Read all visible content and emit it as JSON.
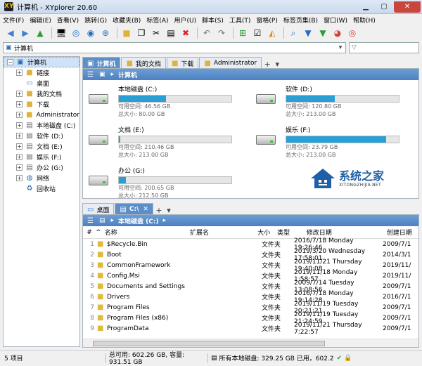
{
  "window": {
    "title": "计算机 - XYplorer 20.60",
    "app_badge": "XY"
  },
  "menu": [
    "文件(F)",
    "编辑(E)",
    "查看(V)",
    "跳转(G)",
    "收藏夹(B)",
    "标签(A)",
    "用户(U)",
    "脚本(S)",
    "工具(T)",
    "窗格(P)",
    "标签页集(B)",
    "窗口(W)",
    "帮助(H)"
  ],
  "address": {
    "value": "计算机"
  },
  "tree": [
    {
      "label": "计算机",
      "level": 0,
      "icon": "computer-icon",
      "expander": "−",
      "selected": true
    },
    {
      "label": "链接",
      "level": 1,
      "icon": "folder-icon",
      "expander": "+"
    },
    {
      "label": "桌面",
      "level": 1,
      "icon": "desktop-icon",
      "expander": ""
    },
    {
      "label": "我的文档",
      "level": 1,
      "icon": "folder-icon",
      "expander": "+"
    },
    {
      "label": "下载",
      "level": 1,
      "icon": "folder-icon",
      "expander": "+"
    },
    {
      "label": "Administrator",
      "level": 1,
      "icon": "folder-icon",
      "expander": "+"
    },
    {
      "label": "本地磁盘 (C:)",
      "level": 1,
      "icon": "drive-icon",
      "expander": "+"
    },
    {
      "label": "软件 (D:)",
      "level": 1,
      "icon": "drive-icon",
      "expander": "+"
    },
    {
      "label": "文档 (E:)",
      "level": 1,
      "icon": "drive-icon",
      "expander": "+"
    },
    {
      "label": "娱乐 (F:)",
      "level": 1,
      "icon": "drive-icon",
      "expander": "+"
    },
    {
      "label": "办公 (G:)",
      "level": 1,
      "icon": "drive-icon",
      "expander": "+"
    },
    {
      "label": "网络",
      "level": 1,
      "icon": "network-icon",
      "expander": "+"
    },
    {
      "label": "回收站",
      "level": 1,
      "icon": "recycle-bin-icon",
      "expander": ""
    }
  ],
  "upper": {
    "tabs": [
      "计算机",
      "我的文档",
      "下载",
      "Administrator"
    ],
    "path": "计算机",
    "drives": [
      {
        "name": "本地磁盘 (C:)",
        "free": "可用空间: 46.56 GB",
        "total": "总大小: 80.00 GB",
        "used_fraction": 0.42
      },
      {
        "name": "软件 (D:)",
        "free": "可用空间: 120.80 GB",
        "total": "总大小: 213.00 GB",
        "used_fraction": 0.43
      },
      {
        "name": "文档 (E:)",
        "free": "可用空间: 210.46 GB",
        "total": "总大小: 213.00 GB",
        "used_fraction": 0.01
      },
      {
        "name": "娱乐 (F:)",
        "free": "可用空间: 23.79 GB",
        "total": "总大小: 213.00 GB",
        "used_fraction": 0.89
      },
      {
        "name": "办公 (G:)",
        "free": "可用空间: 200.65 GB",
        "total": "总大小: 212.50 GB",
        "used_fraction": 0.06
      }
    ]
  },
  "lower": {
    "tabs": [
      "桌面",
      "C:\\"
    ],
    "path": "本地磁盘 (C:)",
    "columns": [
      "#",
      "名称",
      "扩展名",
      "大小",
      "类型",
      "修改日期",
      "创建日期"
    ],
    "rows": [
      {
        "n": "1",
        "name": "$Recycle.Bin",
        "type": "文件夹",
        "modified": "2016/7/18 Monday 19:26:46",
        "created": "2009/7/1"
      },
      {
        "n": "2",
        "name": "Boot",
        "type": "文件夹",
        "modified": "2019/3/20 Wednesday 17:58:01",
        "created": "2014/3/1"
      },
      {
        "n": "3",
        "name": "CommonFramework",
        "type": "文件夹",
        "modified": "2019/11/21 Thursday 19:40:08",
        "created": "2019/11/"
      },
      {
        "n": "4",
        "name": "Config.Msi",
        "type": "文件夹",
        "modified": "2019/11/18 Monday 1:58:57",
        "created": "2019/11/"
      },
      {
        "n": "5",
        "name": "Documents and Settings",
        "type": "文件夹",
        "modified": "2009/7/14 Tuesday 13:08:56",
        "created": "2009/7/1"
      },
      {
        "n": "6",
        "name": "Drivers",
        "type": "文件夹",
        "modified": "2016/7/18 Monday 19:14:28",
        "created": "2016/7/1"
      },
      {
        "n": "7",
        "name": "Program Files",
        "type": "文件夹",
        "modified": "2019/11/19 Tuesday 20:21:21",
        "created": "2009/7/1"
      },
      {
        "n": "8",
        "name": "Program Files (x86)",
        "type": "文件夹",
        "modified": "2019/11/19 Tuesday 21:24:59",
        "created": "2009/7/1"
      },
      {
        "n": "9",
        "name": "ProgramData",
        "type": "文件夹",
        "modified": "2019/11/21 Thursday 7:22:57",
        "created": "2009/7/1"
      }
    ]
  },
  "status": {
    "items": "5 项目",
    "disk": "总可用: 602.26 GB, 容量: 931.51 GB",
    "all": "所有本地磁盘: 329.25 GB 已用，602.2"
  },
  "watermark": {
    "title": "系统之家",
    "sub": "XITONGZHIJIA.NET"
  },
  "colors": {
    "accent": "#2a9fd6",
    "tab_active": "#5c8fc9"
  }
}
